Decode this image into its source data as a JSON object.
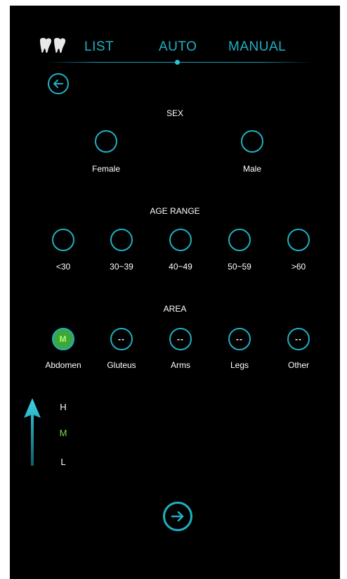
{
  "colors": {
    "accent": "#1fb0c4",
    "selected": "#3da63d",
    "selected_text": "#7cdc3c",
    "background": "#000000"
  },
  "nav": {
    "tabs": [
      {
        "label": "LIST"
      },
      {
        "label": "AUTO",
        "active": true
      },
      {
        "label": "MANUAL"
      }
    ],
    "logo_icon": "tooth-logo-icon",
    "back_icon": "arrow-left-icon"
  },
  "sex": {
    "title": "SEX",
    "options": [
      {
        "label": "Female"
      },
      {
        "label": "Male"
      }
    ]
  },
  "age": {
    "title": "AGE RANGE",
    "options": [
      {
        "label": "<30"
      },
      {
        "label": "30~39"
      },
      {
        "label": "40~49"
      },
      {
        "label": "50~59"
      },
      {
        "label": ">60"
      }
    ]
  },
  "area": {
    "title": "AREA",
    "options": [
      {
        "label": "Abdomen",
        "value": "M",
        "selected": true
      },
      {
        "label": "Gluteus",
        "value": "--"
      },
      {
        "label": "Arms",
        "value": "--"
      },
      {
        "label": "Legs",
        "value": "--"
      },
      {
        "label": "Other",
        "value": "--"
      }
    ]
  },
  "intensity": {
    "levels": [
      {
        "label": "H"
      },
      {
        "label": "M",
        "active": true
      },
      {
        "label": "L"
      }
    ],
    "arrow_icon": "arrow-up-icon"
  },
  "next_icon": "arrow-right-icon"
}
